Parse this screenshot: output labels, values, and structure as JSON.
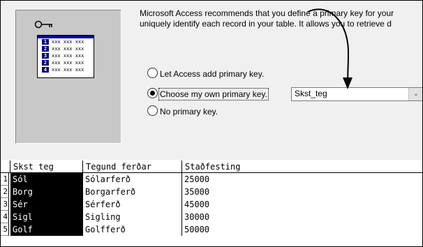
{
  "wizard": {
    "message_line1": "Microsoft Access recommends that you define a primary key for your",
    "message_line2": "uniquely identify each record in your table. It allows you to retrieve d",
    "options": [
      {
        "label": "Let Access add primary key.",
        "selected": false
      },
      {
        "label": "Choose my own primary key.",
        "selected": true
      },
      {
        "label": "No primary key.",
        "selected": false
      }
    ],
    "key_field_value": "Skst_teg",
    "dropdown_glyph": "⌄"
  },
  "illustration": {
    "rows": [
      {
        "num": "1",
        "data": "xxx xxx xxx"
      },
      {
        "num": "2",
        "data": "xxx xxx xxx"
      },
      {
        "num": "3",
        "data": "xxx xxx xxx"
      },
      {
        "num": "2",
        "data": "xxx xxx xxx"
      },
      {
        "num": "4",
        "data": "xxx xxx xxx"
      }
    ]
  },
  "table": {
    "columns": [
      "Skst teg",
      "Tegund ferðar",
      "Staðfesting"
    ],
    "rows": [
      {
        "num": "1",
        "cells": [
          "Sól",
          "Sólarferð",
          "25000"
        ]
      },
      {
        "num": "2",
        "cells": [
          "Borg",
          "Borgarferð",
          "35000"
        ]
      },
      {
        "num": "3",
        "cells": [
          "Sér",
          "Sérferð",
          "45000"
        ]
      },
      {
        "num": "4",
        "cells": [
          "Sigl",
          "Sigling",
          "30000"
        ]
      },
      {
        "num": "5",
        "cells": [
          "Golf",
          "Golfferð",
          "50000"
        ]
      }
    ]
  },
  "colors": {
    "pk_column": "#000000",
    "arrow": "#000000"
  }
}
